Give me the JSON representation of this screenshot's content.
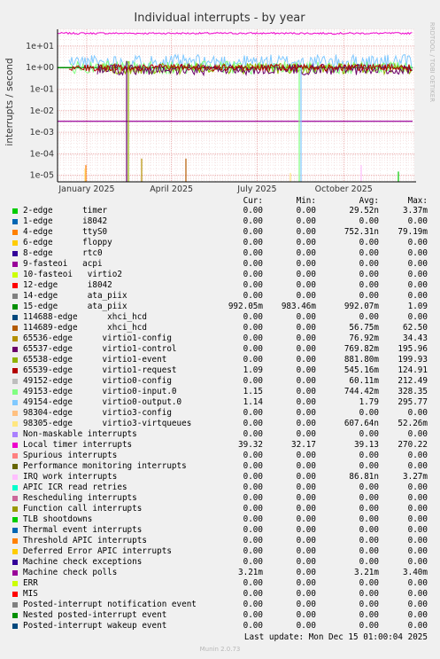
{
  "chart_data": {
    "type": "line",
    "title": "Individual interrupts - by year",
    "ylabel": "interrupts / second",
    "y_scale": "log",
    "ylim": [
      5e-06,
      60
    ],
    "y_ticks": [
      "1e+01",
      "1e+00",
      "1e-01",
      "1e-02",
      "1e-03",
      "1e-04",
      "1e-05"
    ],
    "y_tick_values": [
      10,
      1,
      0.1,
      0.01,
      0.001,
      0.0001,
      1e-05
    ],
    "x_ticks": [
      "January 2025",
      "April 2025",
      "July 2025",
      "October 2025"
    ],
    "x_tick_dates": [
      "2025-01-01",
      "2025-04-01",
      "2025-07-01",
      "2025-10-01"
    ],
    "xlim": [
      "2024-12-01",
      "2025-12-15"
    ],
    "grid": true,
    "side_label": "RRDTOOL / TOBI OETIKER",
    "columns": [
      "Cur:",
      "Min:",
      "Avg:",
      "Max:"
    ],
    "series": [
      {
        "name": "2-edge      timer",
        "color": "#00cc00",
        "cur": "0.00",
        "min": "0.00",
        "avg": "29.52n",
        "max": "3.37m"
      },
      {
        "name": "1-edge      i8042",
        "color": "#0066b3",
        "cur": "0.00",
        "min": "0.00",
        "avg": "0.00",
        "max": "0.00"
      },
      {
        "name": "4-edge      ttyS0",
        "color": "#ff8000",
        "cur": "0.00",
        "min": "0.00",
        "avg": "752.31n",
        "max": "79.19m"
      },
      {
        "name": "6-edge      floppy",
        "color": "#ffcc00",
        "cur": "0.00",
        "min": "0.00",
        "avg": "0.00",
        "max": "0.00"
      },
      {
        "name": "8-edge      rtc0",
        "color": "#330099",
        "cur": "0.00",
        "min": "0.00",
        "avg": "0.00",
        "max": "0.00"
      },
      {
        "name": "9-fasteoi   acpi",
        "color": "#990099",
        "cur": "0.00",
        "min": "0.00",
        "avg": "0.00",
        "max": "0.00"
      },
      {
        "name": "10-fasteoi   virtio2",
        "color": "#ccff00",
        "cur": "0.00",
        "min": "0.00",
        "avg": "0.00",
        "max": "0.00"
      },
      {
        "name": "12-edge      i8042",
        "color": "#ff0000",
        "cur": "0.00",
        "min": "0.00",
        "avg": "0.00",
        "max": "0.00"
      },
      {
        "name": "14-edge      ata_piix",
        "color": "#808080",
        "cur": "0.00",
        "min": "0.00",
        "avg": "0.00",
        "max": "0.00"
      },
      {
        "name": "15-edge      ata_piix",
        "color": "#008f00",
        "cur": "992.05m",
        "min": "983.46m",
        "avg": "992.07m",
        "max": "1.09"
      },
      {
        "name": "114688-edge      xhci_hcd",
        "color": "#00487d",
        "cur": "0.00",
        "min": "0.00",
        "avg": "0.00",
        "max": "0.00"
      },
      {
        "name": "114689-edge      xhci_hcd",
        "color": "#b35a00",
        "cur": "0.00",
        "min": "0.00",
        "avg": "56.75m",
        "max": "62.50"
      },
      {
        "name": "65536-edge      virtio1-config",
        "color": "#b38f00",
        "cur": "0.00",
        "min": "0.00",
        "avg": "76.92m",
        "max": "34.43"
      },
      {
        "name": "65537-edge      virtio1-control",
        "color": "#6b006b",
        "cur": "0.00",
        "min": "0.00",
        "avg": "769.82m",
        "max": "195.96"
      },
      {
        "name": "65538-edge      virtio1-event",
        "color": "#8fb300",
        "cur": "0.00",
        "min": "0.00",
        "avg": "881.80m",
        "max": "199.93"
      },
      {
        "name": "65539-edge      virtio1-request",
        "color": "#b30000",
        "cur": "1.09",
        "min": "0.00",
        "avg": "545.16m",
        "max": "124.91"
      },
      {
        "name": "49152-edge      virtio0-config",
        "color": "#bebebe",
        "cur": "0.00",
        "min": "0.00",
        "avg": "60.11m",
        "max": "212.49"
      },
      {
        "name": "49153-edge      virtio0-input.0",
        "color": "#80ff80",
        "cur": "1.15",
        "min": "0.00",
        "avg": "744.42m",
        "max": "328.35"
      },
      {
        "name": "49154-edge      virtio0-output.0",
        "color": "#80c9ff",
        "cur": "1.14",
        "min": "0.00",
        "avg": "1.79",
        "max": "295.77"
      },
      {
        "name": "98304-edge      virtio3-config",
        "color": "#ffc080",
        "cur": "0.00",
        "min": "0.00",
        "avg": "0.00",
        "max": "0.00"
      },
      {
        "name": "98305-edge      virtio3-virtqueues",
        "color": "#ffe680",
        "cur": "0.00",
        "min": "0.00",
        "avg": "607.64n",
        "max": "52.26m"
      },
      {
        "name": "Non-maskable interrupts",
        "color": "#aa80ff",
        "cur": "0.00",
        "min": "0.00",
        "avg": "0.00",
        "max": "0.00"
      },
      {
        "name": "Local timer interrupts",
        "color": "#ee00cc",
        "cur": "39.32",
        "min": "32.17",
        "avg": "39.13",
        "max": "270.22"
      },
      {
        "name": "Spurious interrupts",
        "color": "#ff8080",
        "cur": "0.00",
        "min": "0.00",
        "avg": "0.00",
        "max": "0.00"
      },
      {
        "name": "Performance monitoring interrupts",
        "color": "#666600",
        "cur": "0.00",
        "min": "0.00",
        "avg": "0.00",
        "max": "0.00"
      },
      {
        "name": "IRQ work interrupts",
        "color": "#ffbfff",
        "cur": "0.00",
        "min": "0.00",
        "avg": "86.81n",
        "max": "3.27m"
      },
      {
        "name": "APIC ICR read retries",
        "color": "#00ffcc",
        "cur": "0.00",
        "min": "0.00",
        "avg": "0.00",
        "max": "0.00"
      },
      {
        "name": "Rescheduling interrupts",
        "color": "#cc6699",
        "cur": "0.00",
        "min": "0.00",
        "avg": "0.00",
        "max": "0.00"
      },
      {
        "name": "Function call interrupts",
        "color": "#999900",
        "cur": "0.00",
        "min": "0.00",
        "avg": "0.00",
        "max": "0.00"
      },
      {
        "name": "TLB shootdowns",
        "color": "#00cc00",
        "cur": "0.00",
        "min": "0.00",
        "avg": "0.00",
        "max": "0.00"
      },
      {
        "name": "Thermal event interrupts",
        "color": "#0066b3",
        "cur": "0.00",
        "min": "0.00",
        "avg": "0.00",
        "max": "0.00"
      },
      {
        "name": "Threshold APIC interrupts",
        "color": "#ff8000",
        "cur": "0.00",
        "min": "0.00",
        "avg": "0.00",
        "max": "0.00"
      },
      {
        "name": "Deferred Error APIC interrupts",
        "color": "#ffcc00",
        "cur": "0.00",
        "min": "0.00",
        "avg": "0.00",
        "max": "0.00"
      },
      {
        "name": "Machine check exceptions",
        "color": "#330099",
        "cur": "0.00",
        "min": "0.00",
        "avg": "0.00",
        "max": "0.00"
      },
      {
        "name": "Machine check polls",
        "color": "#990099",
        "cur": "3.21m",
        "min": "0.00",
        "avg": "3.21m",
        "max": "3.40m"
      },
      {
        "name": "ERR",
        "color": "#ccff00",
        "cur": "0.00",
        "min": "0.00",
        "avg": "0.00",
        "max": "0.00"
      },
      {
        "name": "MIS",
        "color": "#ff0000",
        "cur": "0.00",
        "min": "0.00",
        "avg": "0.00",
        "max": "0.00"
      },
      {
        "name": "Posted-interrupt notification event",
        "color": "#808080",
        "cur": "0.00",
        "min": "0.00",
        "avg": "0.00",
        "max": "0.00"
      },
      {
        "name": "Nested posted-interrupt event",
        "color": "#008f00",
        "cur": "0.00",
        "min": "0.00",
        "avg": "0.00",
        "max": "0.00"
      },
      {
        "name": "Posted-interrupt wakeup event",
        "color": "#00487d",
        "cur": "0.00",
        "min": "0.00",
        "avg": "0.00",
        "max": "0.00"
      }
    ]
  },
  "footer": {
    "last_update": "Last update: Mon Dec 15 01:00:04 2025",
    "version": "Munin 2.0.73"
  }
}
